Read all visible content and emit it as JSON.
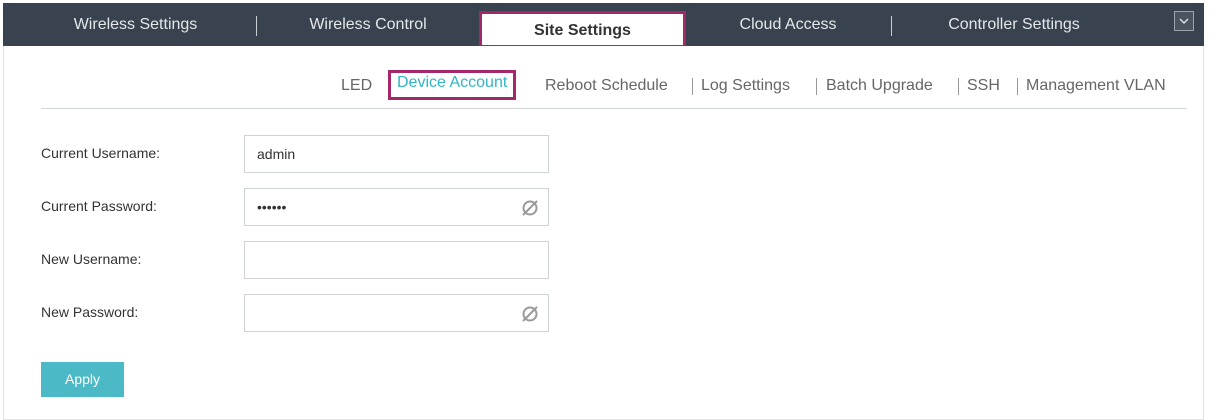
{
  "topnav": {
    "tabs": [
      {
        "label": "Wireless Settings"
      },
      {
        "label": "Wireless Control"
      },
      {
        "label": "Site Settings"
      },
      {
        "label": "Cloud Access"
      },
      {
        "label": "Controller Settings"
      }
    ],
    "active_tab": "Site Settings",
    "menu_icon": "chevron-down-icon"
  },
  "subnav": {
    "items": [
      {
        "label": "LED"
      },
      {
        "label": "Device Account"
      },
      {
        "label": "Reboot Schedule"
      },
      {
        "label": "Log Settings"
      },
      {
        "label": "Batch Upgrade"
      },
      {
        "label": "SSH"
      },
      {
        "label": "Management VLAN"
      }
    ],
    "active_item": "Device Account"
  },
  "form": {
    "current_username": {
      "label": "Current Username:",
      "value": "admin"
    },
    "current_password": {
      "label": "Current Password:",
      "value": "••••••",
      "icon": "eye-slash-icon"
    },
    "new_username": {
      "label": "New Username:",
      "value": ""
    },
    "new_password": {
      "label": "New Password:",
      "value": "",
      "icon": "eye-slash-icon"
    },
    "apply_label": "Apply"
  },
  "colors": {
    "nav_bg": "#38434f",
    "highlight_border": "#a4276a",
    "accent": "#2fb5c5",
    "button": "#4cb9c6"
  }
}
